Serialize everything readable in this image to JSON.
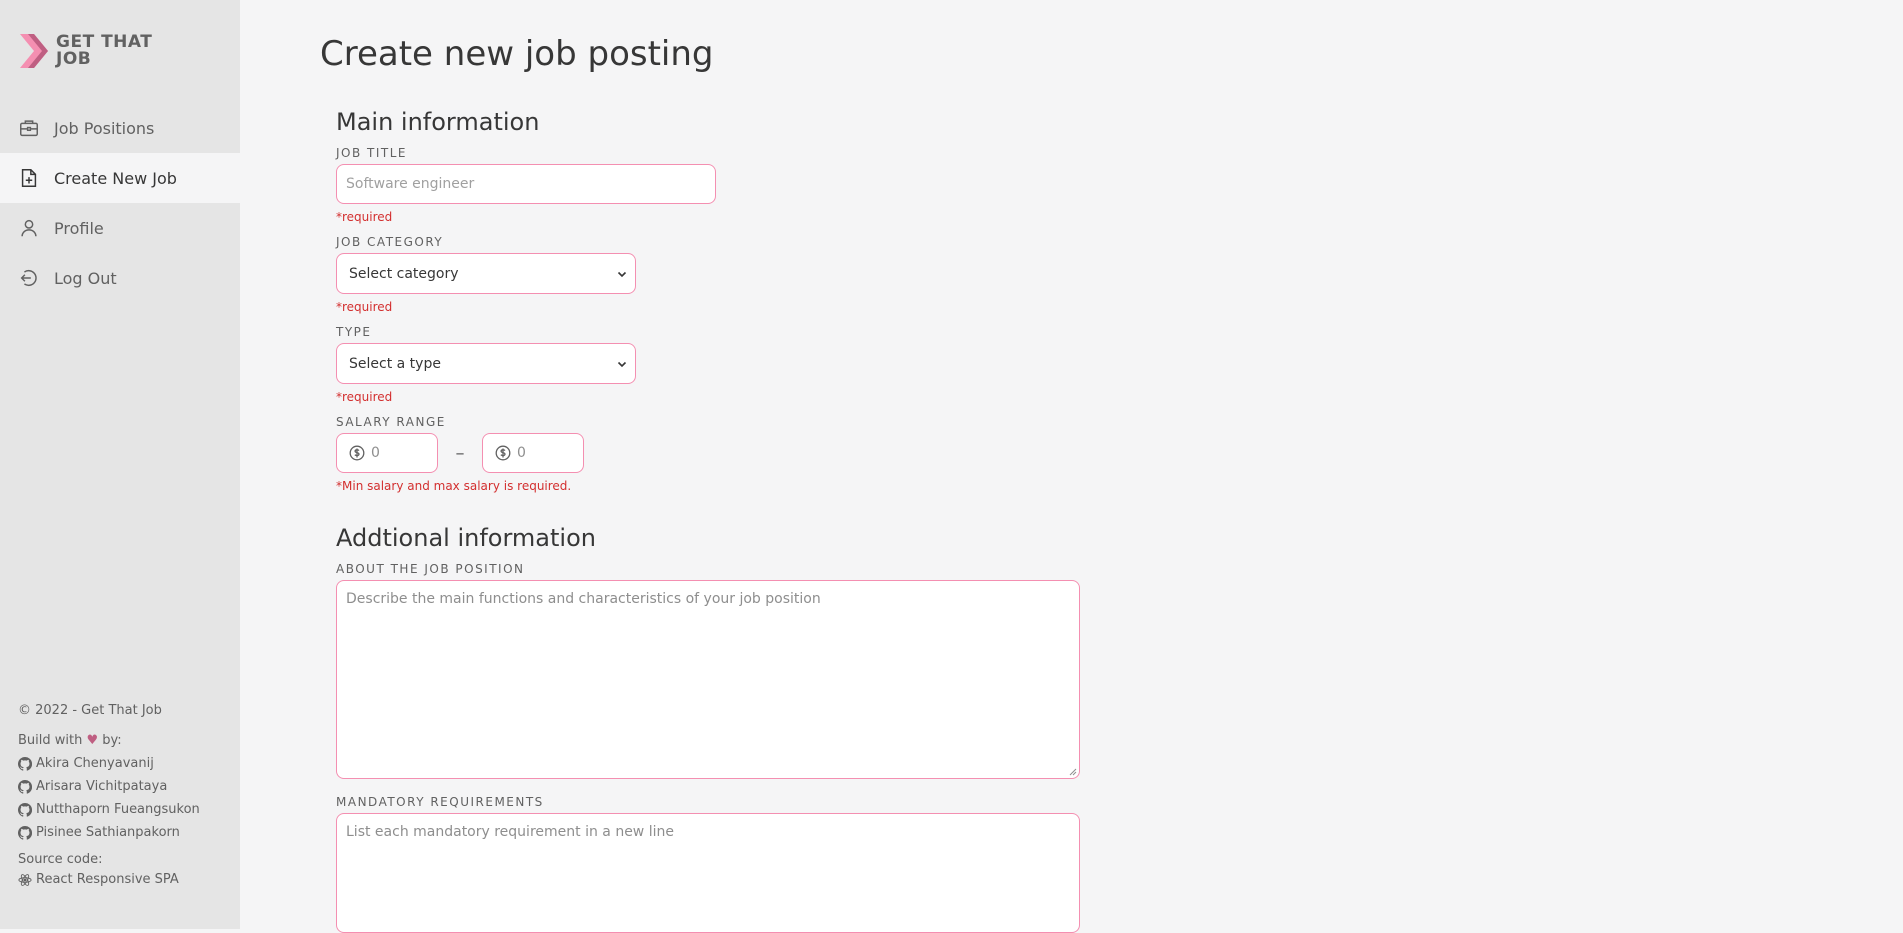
{
  "sidebar": {
    "logo": {
      "line1": "GET THAT",
      "line2": "JOB"
    },
    "items": [
      {
        "label": "Job Positions",
        "icon": "briefcase-icon",
        "active": false
      },
      {
        "label": "Create New Job",
        "icon": "file-plus-icon",
        "active": true
      },
      {
        "label": "Profile",
        "icon": "user-icon",
        "active": false
      },
      {
        "label": "Log Out",
        "icon": "logout-icon",
        "active": false
      }
    ],
    "footer": {
      "copyright": "© 2022 - Get That Job",
      "built_prefix": "Build with",
      "built_suffix": "by:",
      "authors": [
        "Akira Chenyavanij",
        "Arisara Vichitpataya",
        "Nutthaporn Fueangsukon",
        "Pisinee Sathianpakorn"
      ],
      "source_label": "Source code:",
      "source_link": "React Responsive SPA"
    }
  },
  "main": {
    "page_title": "Create new job posting",
    "main_info": {
      "section_title": "Main information",
      "job_title": {
        "label": "JOB TITLE",
        "placeholder": "Software engineer",
        "error": "*required"
      },
      "job_category": {
        "label": "JOB CATEGORY",
        "selected": "Select category",
        "error": "*required"
      },
      "type": {
        "label": "TYPE",
        "selected": "Select a type",
        "error": "*required"
      },
      "salary": {
        "label": "SALARY RANGE",
        "min_placeholder": "0",
        "max_placeholder": "0",
        "separator": "–",
        "error": "*Min salary and max salary is required."
      }
    },
    "additional_info": {
      "section_title": "Addtional information",
      "about": {
        "label": "ABOUT THE JOB POSITION",
        "placeholder": "Describe the main functions and characteristics of your job position"
      },
      "mandatory": {
        "label": "MANDATORY REQUIREMENTS",
        "placeholder": "List each mandatory requirement in a new line"
      }
    }
  },
  "colors": {
    "accent_pink": "#f48fb1",
    "error_red": "#d32f2f",
    "sidebar_bg": "#e5e5e5",
    "page_bg": "#f5f5f6"
  }
}
